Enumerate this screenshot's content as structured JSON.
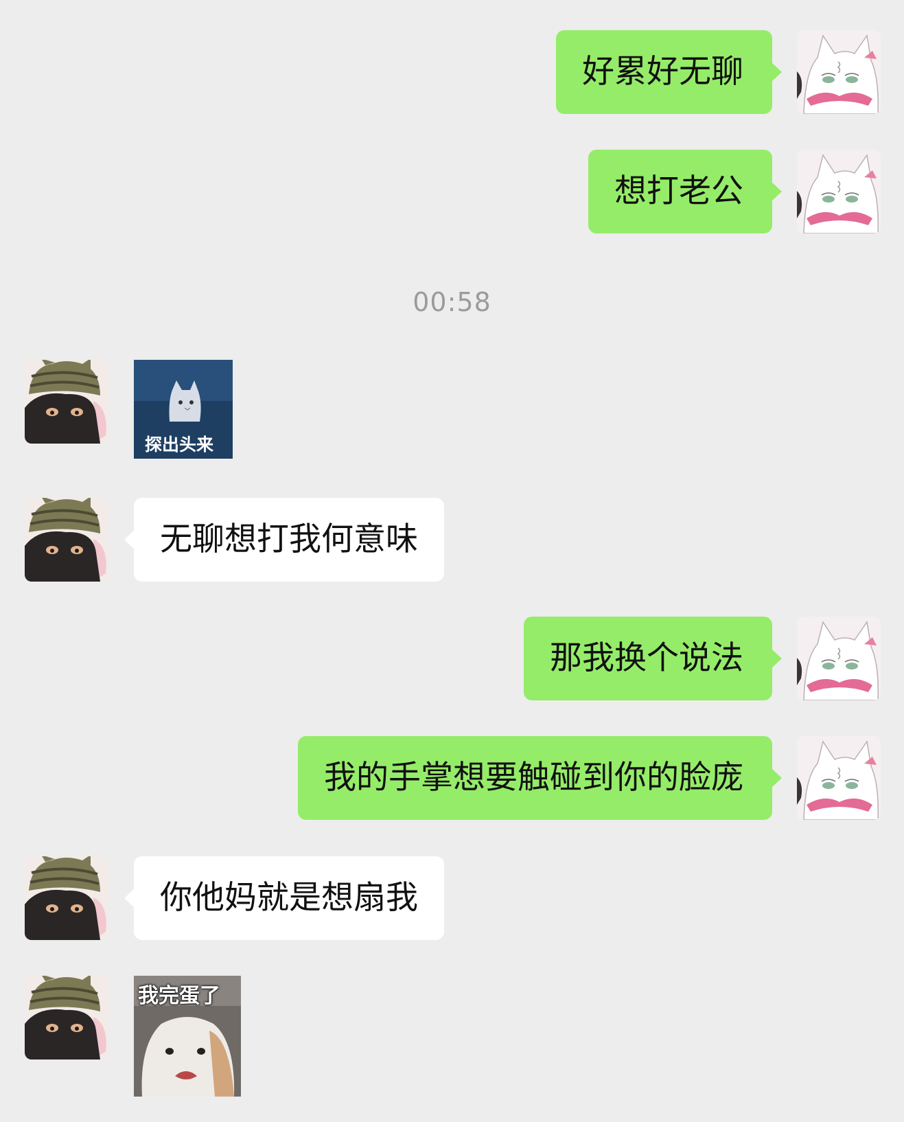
{
  "conversation": {
    "timestamp": "00:58",
    "messages": [
      {
        "side": "right",
        "type": "text",
        "text": "好累好无聊"
      },
      {
        "side": "right",
        "type": "text",
        "text": "想打老公"
      },
      {
        "side": "left",
        "type": "sticker",
        "caption": "探出头来"
      },
      {
        "side": "left",
        "type": "text",
        "text": "无聊想打我何意味"
      },
      {
        "side": "right",
        "type": "text",
        "text": "那我换个说法"
      },
      {
        "side": "right",
        "type": "text",
        "text": "我的手掌想要触碰到你的脸庞"
      },
      {
        "side": "left",
        "type": "text",
        "text": "你他妈就是想扇我"
      },
      {
        "side": "left",
        "type": "sticker",
        "caption": "我完蛋了"
      }
    ]
  },
  "colors": {
    "background": "#ededed",
    "sent_bubble": "#95ec69",
    "received_bubble": "#ffffff",
    "timestamp_text": "#9b9b9b"
  },
  "icons": {
    "self_avatar": "white-cat-avatar",
    "other_avatar": "black-cat-hat-avatar"
  }
}
